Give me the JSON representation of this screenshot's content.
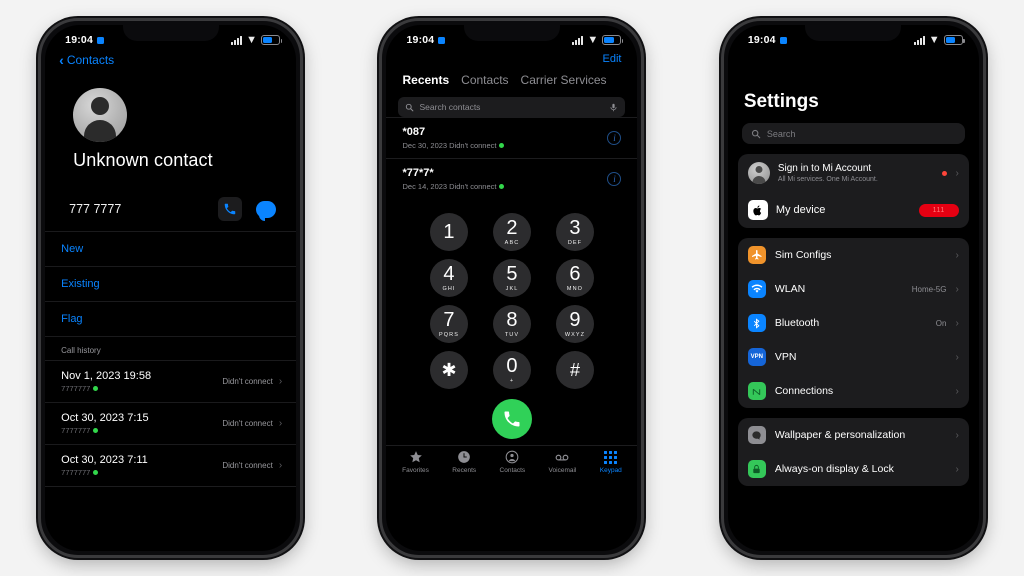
{
  "status_bar": {
    "time": "19:04",
    "battery_pct": 62
  },
  "phone1": {
    "nav_back": "Contacts",
    "contact_name": "Unknown contact",
    "phone_number": "777 7777",
    "action_call": "call-button",
    "action_message": "message-button",
    "links": [
      "New",
      "Existing",
      "Flag"
    ],
    "section_header": "Call history",
    "history": [
      {
        "date": "Nov 1, 2023 19:58",
        "number": "7777777",
        "status": "Didn't connect"
      },
      {
        "date": "Oct 30, 2023 7:15",
        "number": "7777777",
        "status": "Didn't connect"
      },
      {
        "date": "Oct 30, 2023 7:11",
        "number": "7777777",
        "status": "Didn't connect"
      }
    ]
  },
  "phone2": {
    "edit": "Edit",
    "tabs": [
      {
        "label": "Recents",
        "active": true
      },
      {
        "label": "Contacts",
        "active": false
      },
      {
        "label": "Carrier Services",
        "active": false
      }
    ],
    "search_placeholder": "Search contacts",
    "recents": [
      {
        "title": "*087",
        "subtitle": "Dec 30, 2023 Didn't connect"
      },
      {
        "title": "*77*7*",
        "subtitle": "Dec 14, 2023 Didn't connect"
      }
    ],
    "keypad": [
      {
        "num": "1",
        "letters": ""
      },
      {
        "num": "2",
        "letters": "ABC"
      },
      {
        "num": "3",
        "letters": "DEF"
      },
      {
        "num": "4",
        "letters": "GHI"
      },
      {
        "num": "5",
        "letters": "JKL"
      },
      {
        "num": "6",
        "letters": "MNO"
      },
      {
        "num": "7",
        "letters": "PQRS"
      },
      {
        "num": "8",
        "letters": "TUV"
      },
      {
        "num": "9",
        "letters": "WXYZ"
      },
      {
        "num": "✱",
        "letters": ""
      },
      {
        "num": "0",
        "letters": "+"
      },
      {
        "num": "#",
        "letters": ""
      }
    ],
    "call_button": "call-button",
    "tabbar": [
      {
        "label": "Favorites",
        "active": false
      },
      {
        "label": "Recents",
        "active": false
      },
      {
        "label": "Contacts",
        "active": false
      },
      {
        "label": "Voicemail",
        "active": false
      },
      {
        "label": "Keypad",
        "active": true
      }
    ]
  },
  "phone3": {
    "title": "Settings",
    "search_placeholder": "Search",
    "account": {
      "title": "Sign in to Mi Account",
      "subtitle": "All Mi services. One Mi Account."
    },
    "device": {
      "title": "My device",
      "badge": "111"
    },
    "items": [
      {
        "label": "Sim Configs",
        "value": "",
        "icon": "airplane-icon",
        "color": "#f0932b"
      },
      {
        "label": "WLAN",
        "value": "Home-5G",
        "icon": "wifi-icon",
        "color": "#0a84ff"
      },
      {
        "label": "Bluetooth",
        "value": "On",
        "icon": "bluetooth-icon",
        "color": "#0a84ff"
      },
      {
        "label": "VPN",
        "value": "",
        "icon": "vpn-icon",
        "color": "#1565d8"
      },
      {
        "label": "Connections",
        "value": "",
        "icon": "connections-icon",
        "color": "#34c759"
      }
    ],
    "items2": [
      {
        "label": "Wallpaper & personalization",
        "value": "",
        "icon": "wallpaper-icon",
        "color": "#8e8e93"
      },
      {
        "label": "Always-on display & Lock",
        "value": "",
        "icon": "lock-icon",
        "color": "#34c759"
      }
    ]
  },
  "colors": {
    "accent": "#0a84ff",
    "green": "#30d158",
    "red": "#e60012"
  }
}
